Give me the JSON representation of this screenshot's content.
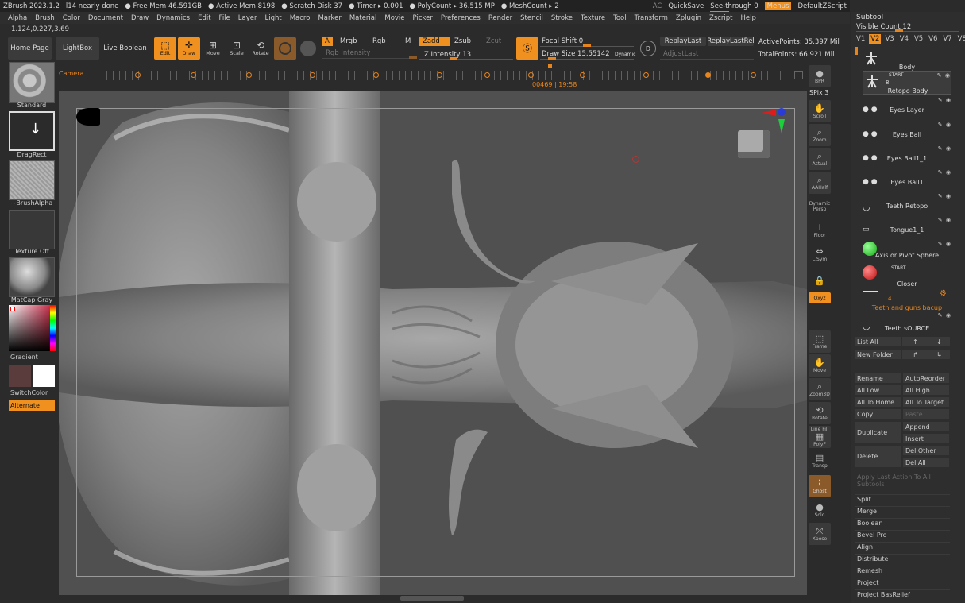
{
  "title": {
    "app": "ZBrush 2023.1.2",
    "doc": "l14 nearly done",
    "free_mem": "● Free Mem 46.591GB",
    "active_mem": "● Active Mem 8198",
    "scratch": "● Scratch Disk 37",
    "timer": "● Timer ▸ 0.001",
    "polycount": "● PolyCount ▸ 36.515 MP",
    "meshcount": "● MeshCount ▸ 2",
    "ac": "AC",
    "quicksave": "QuickSave",
    "see_through": "See-through  0",
    "menus": "Menus",
    "default_zscript": "DefaultZScript"
  },
  "menu": [
    "Alpha",
    "Brush",
    "Color",
    "Document",
    "Draw",
    "Dynamics",
    "Edit",
    "File",
    "Layer",
    "Light",
    "Macro",
    "Marker",
    "Material",
    "Movie",
    "Picker",
    "Preferences",
    "Render",
    "Stencil",
    "Stroke",
    "Texture",
    "Tool",
    "Transform",
    "Zplugin",
    "Zscript",
    "Help"
  ],
  "coords": "1.124,0.227,3.69",
  "toolbar": {
    "home_page": "Home Page",
    "lightbox": "LightBox",
    "live_boolean": "Live Boolean",
    "edit": "Edit",
    "draw": "Draw",
    "move": "Move",
    "scale": "Scale",
    "rotate": "Rotate",
    "a": "A",
    "mrgb": "Mrgb",
    "rgb": "Rgb",
    "m": "M",
    "rgb_intensity": "Rgb Intensity",
    "zadd": "Zadd",
    "zsub": "Zsub",
    "zcut": "Zcut",
    "z_intensity": "Z Intensity 13",
    "focal_shift": "Focal Shift 0",
    "draw_size": "Draw Size 15.55142",
    "dynamic": "Dynamic",
    "replay_last": "ReplayLast",
    "replay_last_rel": "ReplayLastRel",
    "adjust_last": "AdjustLast",
    "active_points": "ActivePoints: 35.397 Mil",
    "total_points": "TotalPoints: 66.921 Mil"
  },
  "timeline": {
    "label": "Camera",
    "time": "00469 | 19:58"
  },
  "left": {
    "standard": "Standard",
    "dragrect": "DragRect",
    "brushalpha": "~BrushAlpha",
    "texture_off": "Texture Off",
    "matcap": "MatCap Gray",
    "gradient": "Gradient",
    "switchcolor": "SwitchColor",
    "alternate": "Alternate"
  },
  "shelf": {
    "bpr": "BPR",
    "spix": "SPix 3",
    "scroll": "Scroll",
    "zoom": "Zoom",
    "actual": "Actual",
    "aahalf": "AAHalf",
    "persp": "Persp",
    "floor": "Floor",
    "lsym": "L.Sym",
    "xyz": "Qxyz",
    "frame": "Frame",
    "move": "Move",
    "zoom3d": "Zoom3D",
    "rotate": "Rotate",
    "polyf": "PolyF",
    "transp": "Transp",
    "ghost": "Ghost",
    "solo": "Solo",
    "xpose": "Xpose",
    "linefill": "Line Fill",
    "dynamic_label": "Dynamic"
  },
  "subtool": {
    "header": "Subtool",
    "visible_count": "Visible Count 12",
    "tabs": [
      "V1",
      "V2",
      "V3",
      "V4",
      "V5",
      "V6",
      "V7",
      "V8"
    ],
    "items": [
      "Body",
      "Retopo Body",
      "Eyes Layer",
      "Eyes Ball",
      "Eyes Ball1_1",
      "Eyes Ball1",
      "Teeth Retopo",
      "Tongue1_1",
      "Axis or Pivot Sphere",
      "Closer",
      "Teeth and guns bacup",
      "Teeth sOURCE"
    ],
    "start": "START",
    "start_num": "8",
    "start2": "START",
    "start2_num": "1",
    "folder_num": "4",
    "list_all": "List All",
    "new_folder": "New Folder",
    "rename": "Rename",
    "autoreorder": "AutoReorder",
    "all_low": "All Low",
    "all_high": "All High",
    "all_to_home": "All To Home",
    "all_to_target": "All To Target",
    "copy": "Copy",
    "paste": "Paste",
    "duplicate": "Duplicate",
    "append": "Append",
    "insert": "Insert",
    "delete": "Delete",
    "del_other": "Del Other",
    "del_all": "Del All",
    "apply_last": "Apply Last Action To All Subtools",
    "list": [
      "Split",
      "Merge",
      "Boolean",
      "Bevel Pro",
      "Align",
      "Distribute",
      "Remesh",
      "Project",
      "Project BasRelief"
    ]
  },
  "colors": {
    "accent": "#f0901e",
    "primary_swatch": "#5a3c3c",
    "secondary_swatch": "#ffffff"
  }
}
